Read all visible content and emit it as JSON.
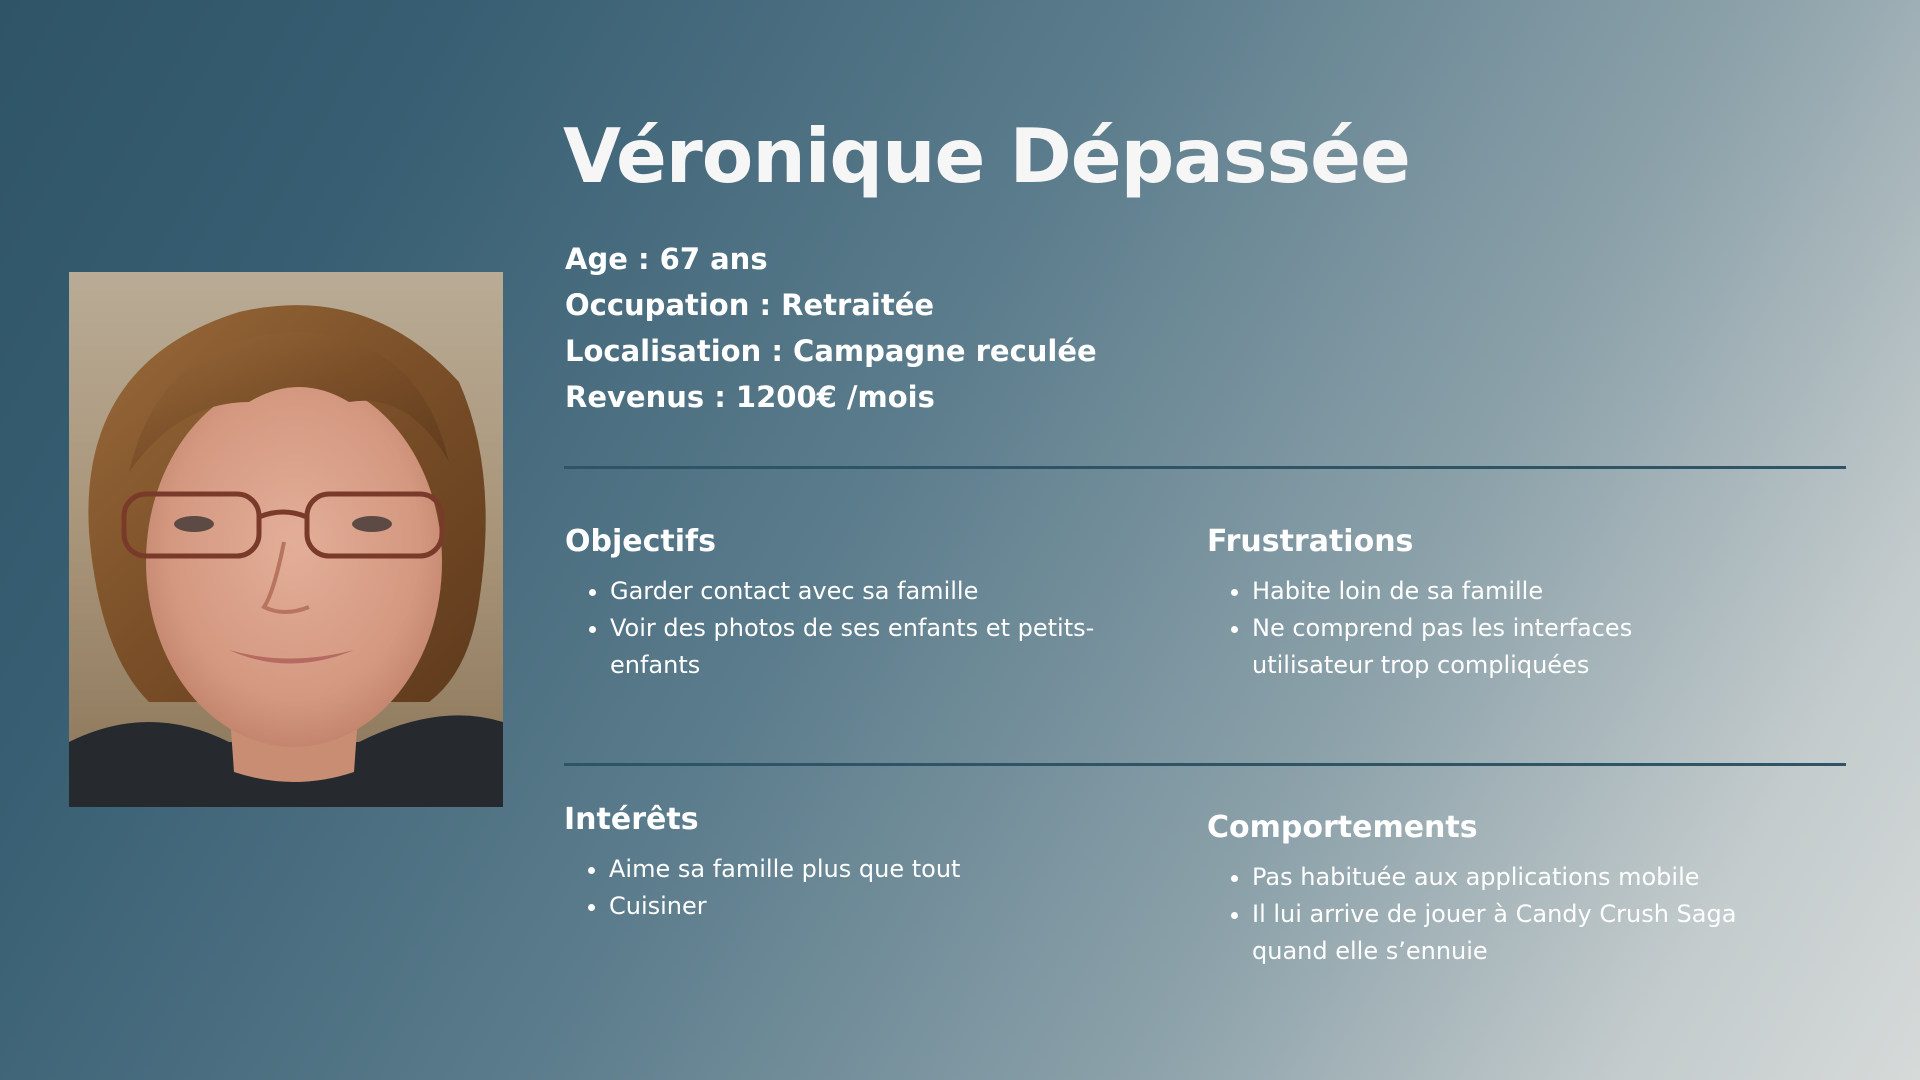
{
  "persona": {
    "name": "Véronique Dépassée",
    "facts": [
      "Age : 67 ans",
      "Occupation : Retraitée",
      "Localisation : Campagne reculée",
      "Revenus : 1200€ /mois"
    ]
  },
  "sections": {
    "objectifs": {
      "title": "Objectifs",
      "items": [
        "Garder contact avec sa famille",
        "Voir des photos de ses enfants et petits-enfants"
      ]
    },
    "frustrations": {
      "title": "Frustrations",
      "items": [
        "Habite loin de sa famille",
        "Ne comprend pas les interfaces utilisateur trop compliquées"
      ]
    },
    "interets": {
      "title": "Intérêts",
      "items": [
        "Aime sa famille plus que tout",
        "Cuisiner"
      ]
    },
    "comportements": {
      "title": "Comportements",
      "items": [
        "Pas habituée aux applications mobile",
        "Il lui arrive de jouer à Candy Crush Saga quand elle s’ennuie"
      ]
    }
  },
  "colors": {
    "background_start": "#2f5467",
    "background_end": "#d6dad9",
    "divider": "#2f5466",
    "text": "#ffffff"
  }
}
